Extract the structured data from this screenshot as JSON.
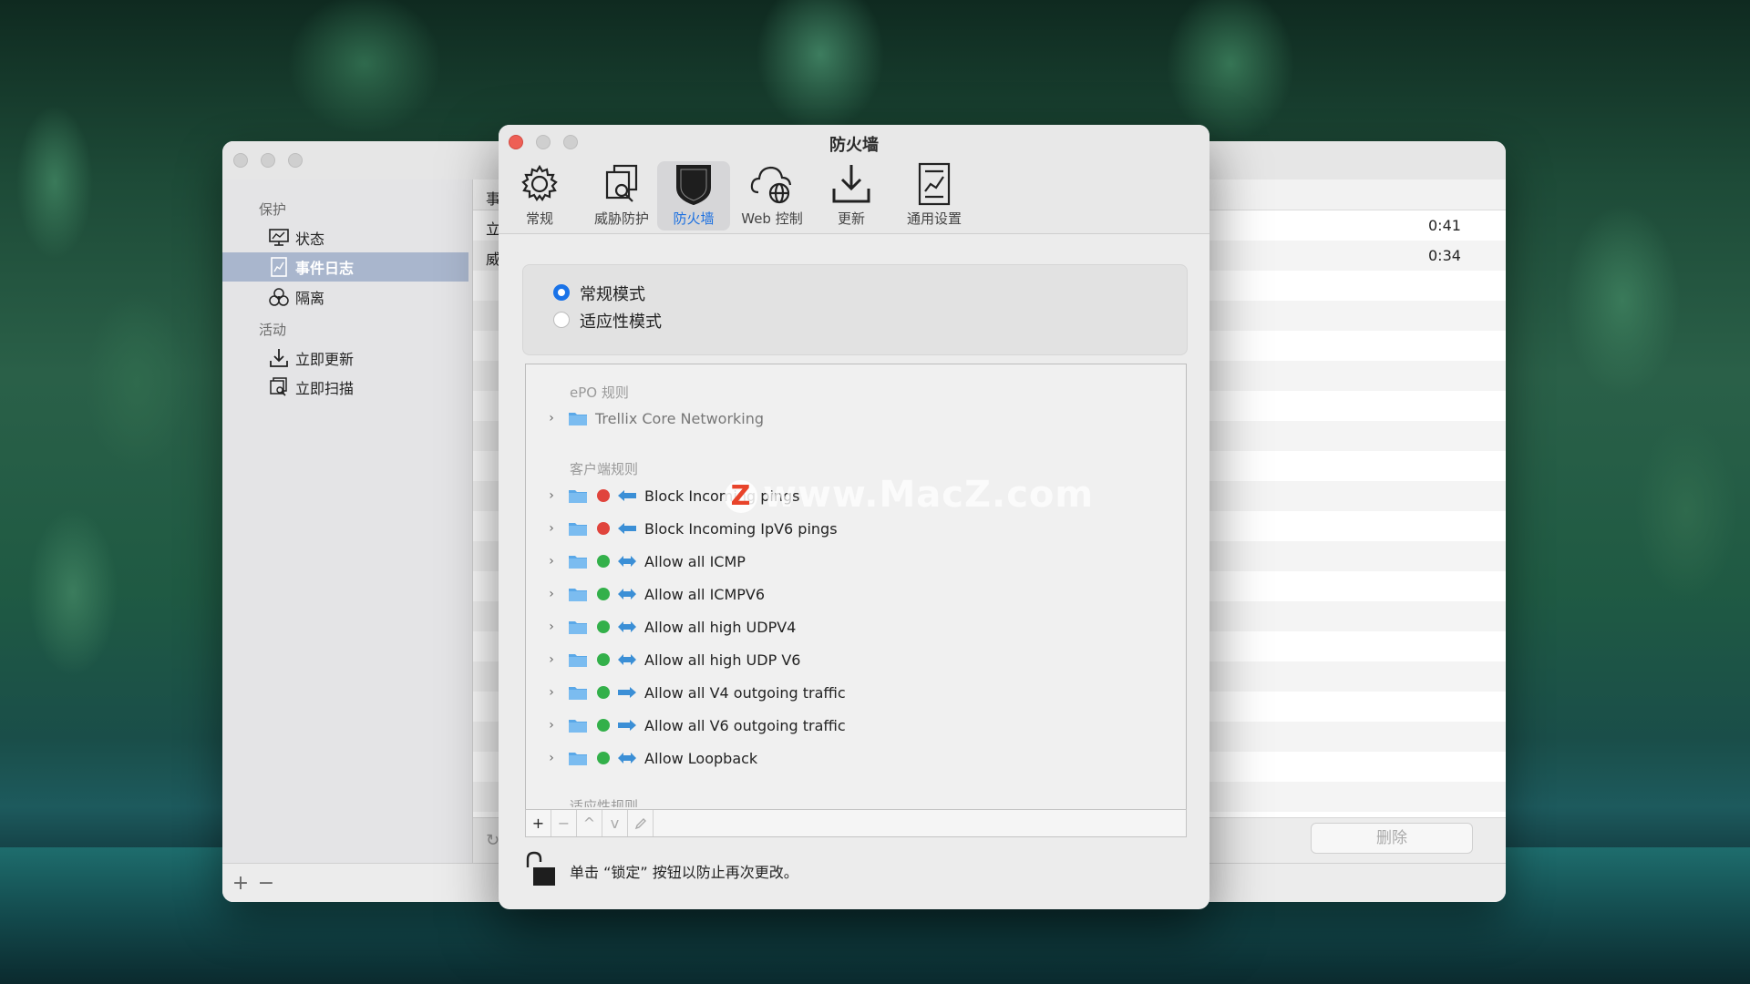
{
  "back_window": {
    "sidebar": {
      "sections": [
        {
          "label": "保护",
          "items": [
            {
              "label": "状态",
              "icon": "monitor-chart-icon"
            },
            {
              "label": "事件日志",
              "icon": "log-chart-icon",
              "selected": true
            },
            {
              "label": "隔离",
              "icon": "biohazard-icon"
            }
          ]
        },
        {
          "label": "活动",
          "items": [
            {
              "label": "立即更新",
              "icon": "download-tray-icon"
            },
            {
              "label": "立即扫描",
              "icon": "scan-window-icon"
            }
          ]
        }
      ]
    },
    "table": {
      "header_col1": "事",
      "rows": [
        {
          "col1": "立",
          "time": "0:41"
        },
        {
          "col1": "威",
          "time": "0:34"
        }
      ]
    },
    "delete_label": "删除",
    "add_symbol": "+",
    "remove_symbol": "−"
  },
  "front_window": {
    "title": "防火墙",
    "toolbar": [
      {
        "label": "常规",
        "icon": "gear-icon"
      },
      {
        "label": "威胁防护",
        "icon": "threat-scan-icon"
      },
      {
        "label": "防火墙",
        "icon": "shield-icon",
        "active": true
      },
      {
        "label": "Web 控制",
        "icon": "cloud-globe-icon"
      },
      {
        "label": "更新",
        "icon": "download-icon"
      },
      {
        "label": "通用设置",
        "icon": "settings-doc-icon"
      }
    ],
    "modes": [
      {
        "label": "常规模式",
        "selected": true
      },
      {
        "label": "适应性模式",
        "selected": false
      }
    ],
    "epo_group": "ePO 规则",
    "epo_rules": [
      {
        "label": "Trellix Core Networking"
      }
    ],
    "client_group": "客户端规则",
    "client_rules": [
      {
        "label": "Block Incoming pings",
        "status": "red",
        "direction": "in"
      },
      {
        "label": "Block Incoming IpV6 pings",
        "status": "red",
        "direction": "in"
      },
      {
        "label": "Allow all ICMP",
        "status": "green",
        "direction": "both"
      },
      {
        "label": "Allow all ICMPV6",
        "status": "green",
        "direction": "both"
      },
      {
        "label": "Allow all high UDPV4",
        "status": "green",
        "direction": "both"
      },
      {
        "label": "Allow all high UDP V6",
        "status": "green",
        "direction": "both"
      },
      {
        "label": "Allow all V4 outgoing traffic",
        "status": "green",
        "direction": "out"
      },
      {
        "label": "Allow all V6 outgoing traffic",
        "status": "green",
        "direction": "out"
      },
      {
        "label": "Allow Loopback",
        "status": "green",
        "direction": "both"
      }
    ],
    "adaptive_group": "适应性规则",
    "rules_toolbar": {
      "add": "+",
      "remove": "−",
      "up": "^",
      "down": "v"
    },
    "lock_text": "单击 “锁定” 按钮以防止再次更改。"
  },
  "watermark": {
    "logo": "Z",
    "text": "www.MacZ.com"
  },
  "colors": {
    "accent": "#1a73e8",
    "selected_sidebar": "#a9b6cd",
    "red_dot": "#e0443c",
    "green_dot": "#33b04a",
    "folder": "#5aa8e8",
    "arrow": "#3b8fd6"
  }
}
